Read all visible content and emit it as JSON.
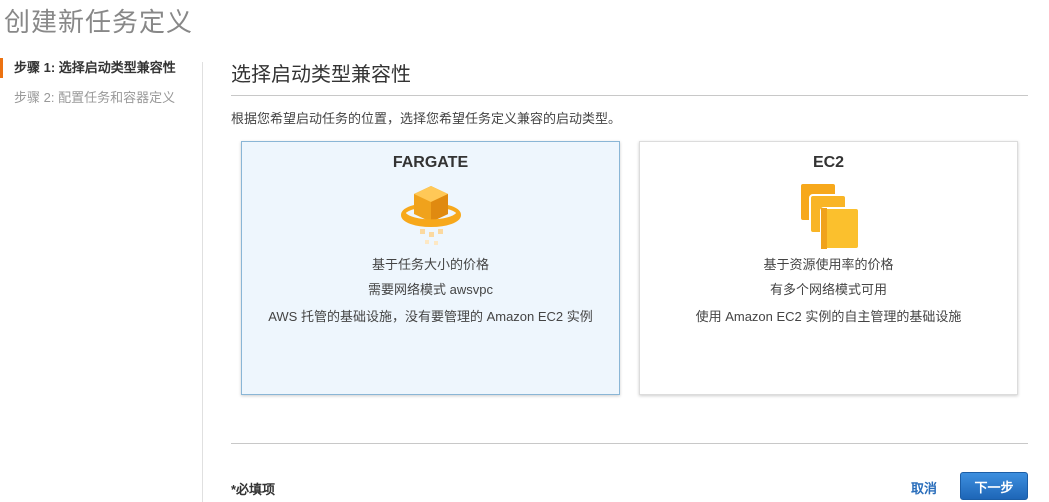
{
  "page": {
    "title": "创建新任务定义"
  },
  "steps": [
    {
      "label": "步骤 1: 选择启动类型兼容性",
      "active": true
    },
    {
      "label": "步骤 2: 配置任务和容器定义",
      "active": false
    }
  ],
  "section": {
    "title": "选择启动类型兼容性",
    "description": "根据您希望启动任务的位置，选择您希望任务定义兼容的启动类型。"
  },
  "cards": [
    {
      "title": "FARGATE",
      "icon": "fargate-icon",
      "selected": true,
      "features": [
        "基于任务大小的价格",
        "需要网络模式 awsvpc",
        "AWS 托管的基础设施，没有要管理的 Amazon EC2 实例"
      ]
    },
    {
      "title": "EC2",
      "icon": "ec2-instances-icon",
      "selected": false,
      "features": [
        "基于资源使用率的价格",
        "有多个网络模式可用",
        "使用 Amazon EC2 实例的自主管理的基础设施"
      ]
    }
  ],
  "footer": {
    "required_note": "*必填项",
    "cancel_label": "取消",
    "next_label": "下一步"
  },
  "colors": {
    "accent": "#ec7211",
    "primary": "#2a6ebb",
    "selected_bg": "#eef6fd",
    "icon_orange": "#f7a81b"
  }
}
